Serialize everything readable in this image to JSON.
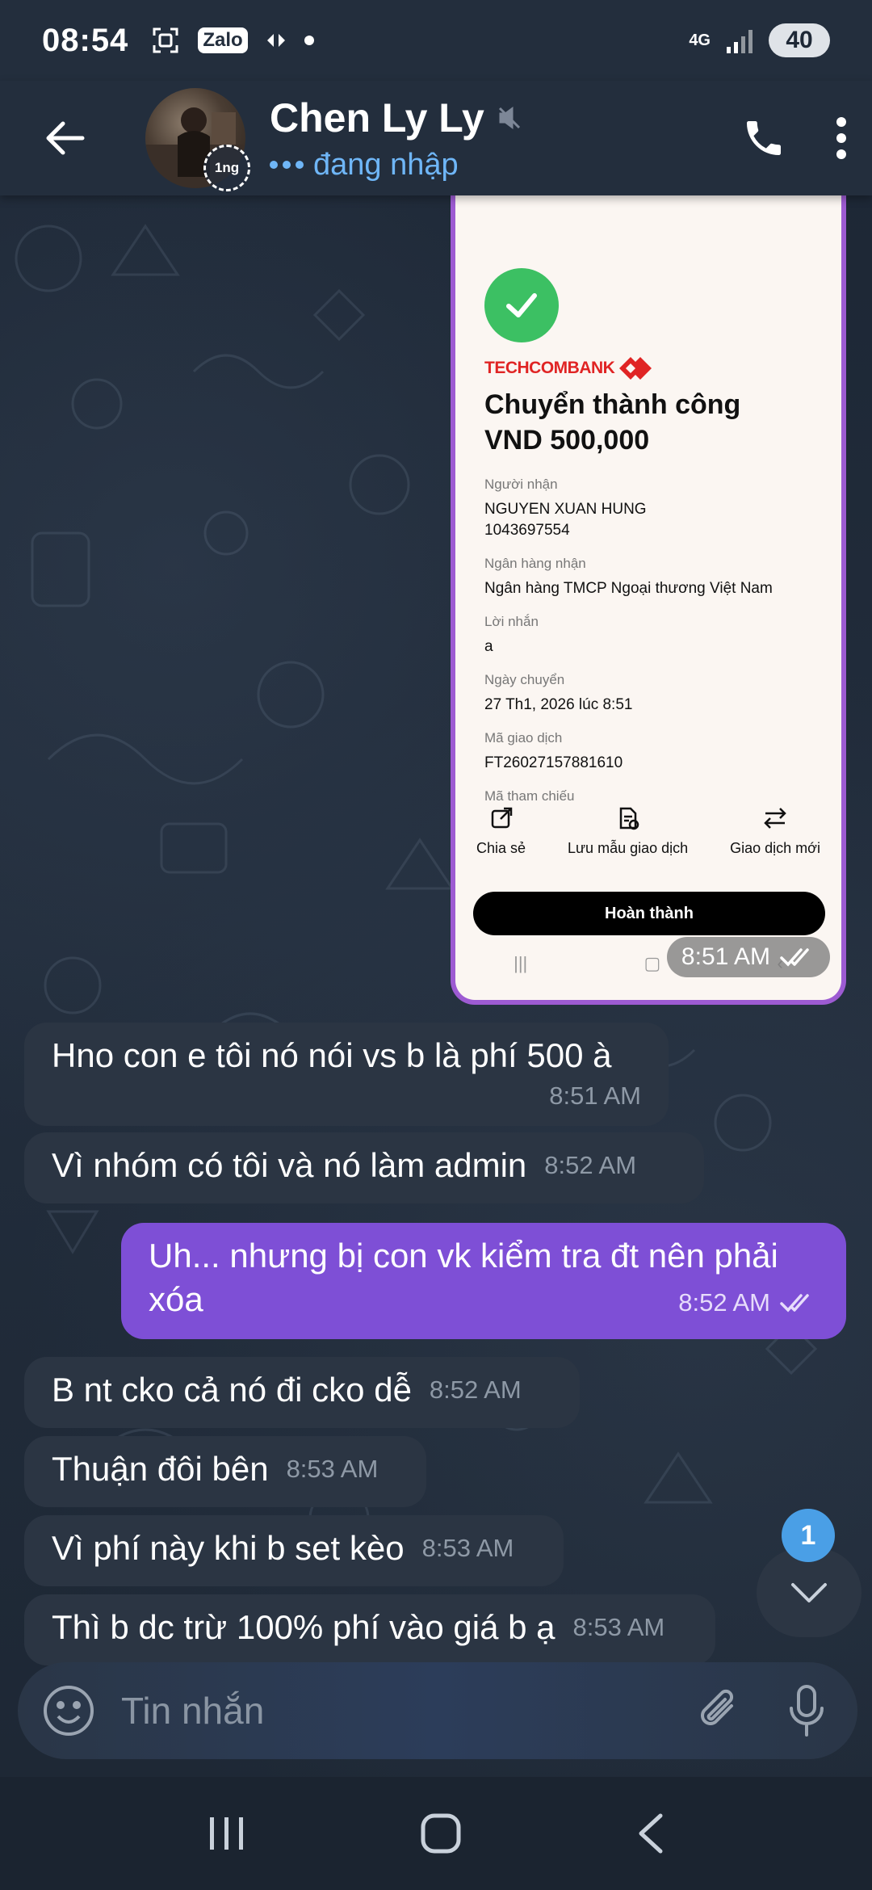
{
  "status_bar": {
    "time": "08:54",
    "app_badge": "Zalo",
    "network": "4G",
    "battery": "40"
  },
  "header": {
    "contact_name": "Chen Ly Ly",
    "status": "đang nhập",
    "avatar_badge": "1ng"
  },
  "receipt": {
    "bank": "TECHCOMBANK",
    "title": "Chuyển thành công",
    "amount": "VND 500,000",
    "fields": [
      {
        "label": "Người nhận",
        "value": "NGUYEN XUAN HUNG",
        "value2": "1043697554"
      },
      {
        "label": "Ngân hàng nhận",
        "value": "Ngân hàng TMCP Ngoại thương Việt Nam"
      },
      {
        "label": "Lời nhắn",
        "value": "a"
      },
      {
        "label": "Ngày chuyển",
        "value": "27 Th1, 2026 lúc 8:51"
      },
      {
        "label": "Mã giao dịch",
        "value": "FT26027157881610"
      },
      {
        "label": "Mã tham chiếu",
        "value": ""
      }
    ],
    "actions": [
      "Chia sẻ",
      "Lưu mẫu giao dịch",
      "Giao dịch mới"
    ],
    "done_label": "Hoàn thành",
    "time": "8:51 AM"
  },
  "messages": [
    {
      "dir": "in",
      "text": "Hno con e tôi nó nói vs b là phí 500 à",
      "time": "8:51 AM"
    },
    {
      "dir": "in",
      "text": "Vì nhóm có tôi và nó làm admin",
      "time": "8:52 AM"
    },
    {
      "dir": "out",
      "text": "Uh... nhưng bị con vk kiểm tra đt nên phải xóa",
      "time": "8:52 AM"
    },
    {
      "dir": "in",
      "text": "B nt cko cả nó đi cko dễ",
      "time": "8:52 AM"
    },
    {
      "dir": "in",
      "text": "Thuận đôi bên",
      "time": "8:53 AM"
    },
    {
      "dir": "in",
      "text": "Vì phí này khi b set kèo",
      "time": "8:53 AM"
    },
    {
      "dir": "in",
      "text": "Thì b dc trừ 100% phí vào giá b ạ",
      "time": "8:53 AM"
    }
  ],
  "unread_count": "1",
  "input": {
    "placeholder": "Tin nhắn"
  },
  "colors": {
    "accent": "#7e4fd6",
    "incoming": "#2b3543",
    "status_blue": "#6fb6f7",
    "check_green": "#3cc063"
  }
}
